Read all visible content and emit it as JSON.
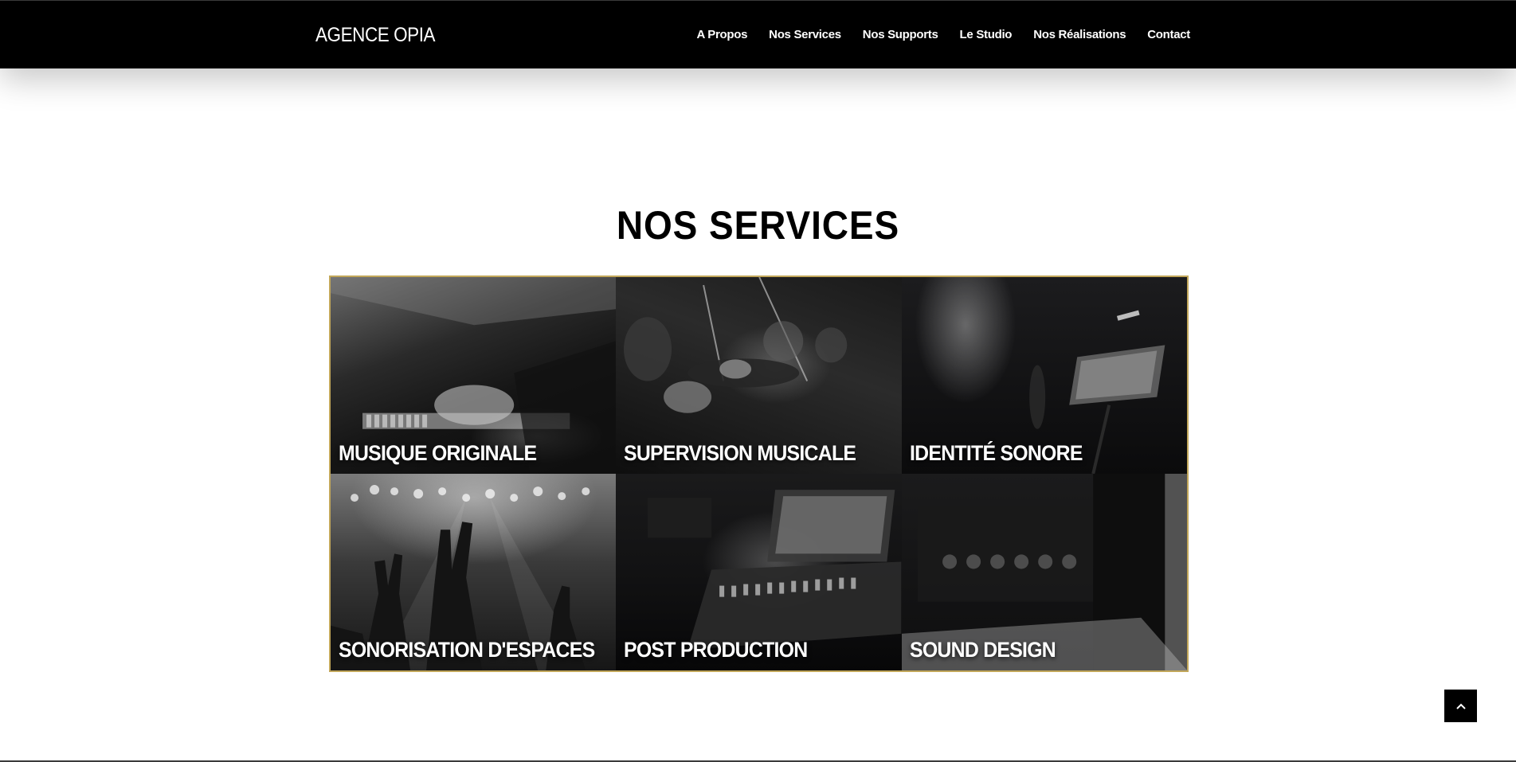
{
  "header": {
    "brand": "AGENCE OPIA",
    "nav": [
      {
        "label": "A Propos"
      },
      {
        "label": "Nos Services"
      },
      {
        "label": "Nos Supports"
      },
      {
        "label": "Le Studio"
      },
      {
        "label": "Nos Réalisations"
      },
      {
        "label": "Contact"
      }
    ]
  },
  "main": {
    "title": "NOS SERVICES",
    "services": [
      {
        "label": "MUSIQUE ORIGINALE"
      },
      {
        "label": "SUPERVISION MUSICALE"
      },
      {
        "label": "IDENTITÉ SONORE"
      },
      {
        "label": "SONORISATION D'ESPACES"
      },
      {
        "label": "POST PRODUCTION"
      },
      {
        "label": "SOUND DESIGN"
      }
    ]
  },
  "scroll_top": {
    "icon": "chevron-up-icon"
  },
  "colors": {
    "header_bg": "#000000",
    "grid_border": "#c2a75a",
    "text_light": "#ffffff",
    "text_dark": "#000000"
  }
}
